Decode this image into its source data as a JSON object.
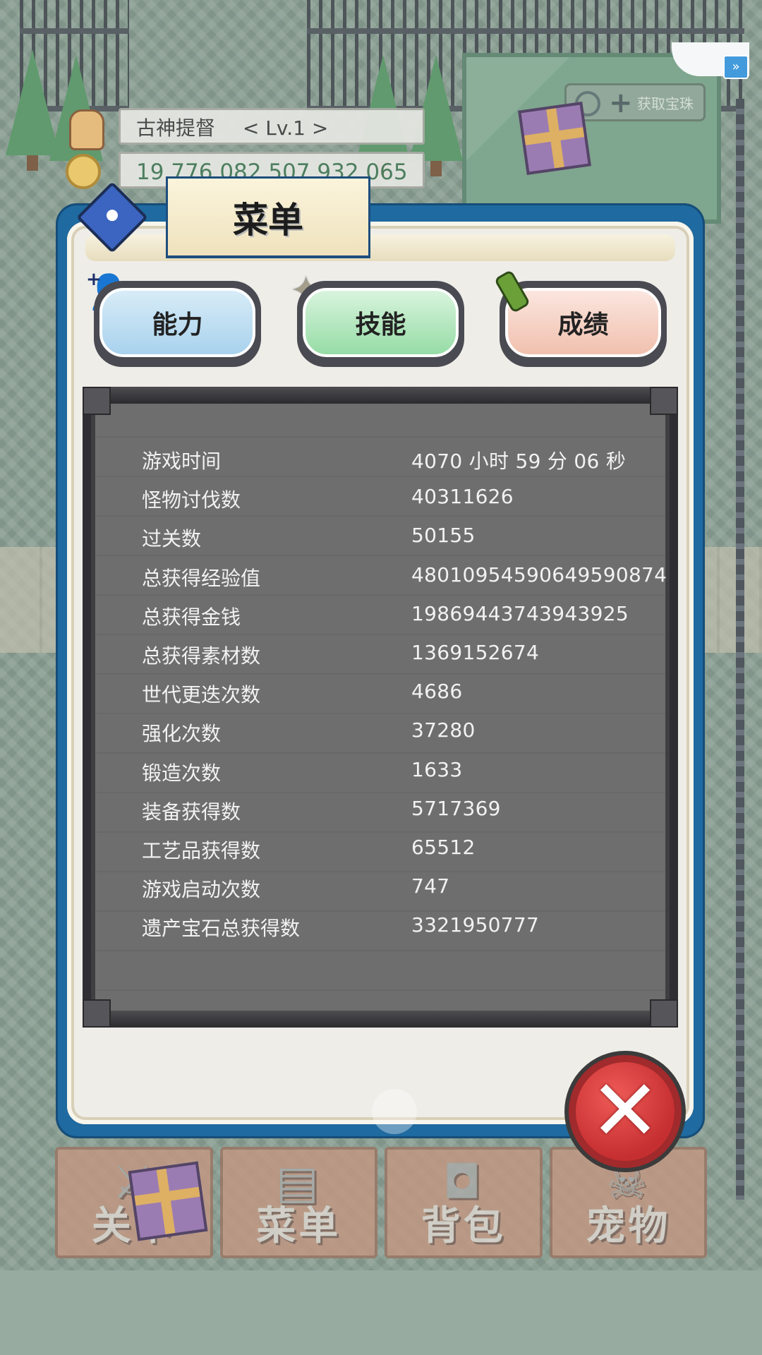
{
  "hud": {
    "player_name": "古神提督",
    "level": "< Lv.1 >",
    "gold": "19,776,082,507,932,065",
    "treasure_button": "获取宝珠",
    "fast_forward_icon": "fast-forward-icon"
  },
  "modal": {
    "title": "菜单",
    "tabs": [
      {
        "label": "能力"
      },
      {
        "label": "技能"
      },
      {
        "label": "成绩"
      }
    ],
    "stats": [
      {
        "label": "游戏时间",
        "value": "4070 小时 59 分 06 秒"
      },
      {
        "label": "怪物讨伐数",
        "value": "40311626"
      },
      {
        "label": "过关数",
        "value": "50155"
      },
      {
        "label": "总获得经验值",
        "value": "48010954590649590874"
      },
      {
        "label": "总获得金钱",
        "value": "19869443743943925"
      },
      {
        "label": "总获得素材数",
        "value": "1369152674"
      },
      {
        "label": "世代更迭次数",
        "value": "4686"
      },
      {
        "label": "强化次数",
        "value": "37280"
      },
      {
        "label": "锻造次数",
        "value": "1633"
      },
      {
        "label": "装备获得数",
        "value": "5717369"
      },
      {
        "label": "工艺品获得数",
        "value": "65512"
      },
      {
        "label": "游戏启动次数",
        "value": "747"
      },
      {
        "label": "遗产宝石总获得数",
        "value": "3321950777"
      }
    ]
  },
  "bottom_nav": [
    {
      "label": "关卡"
    },
    {
      "label": "菜单"
    },
    {
      "label": "背包"
    },
    {
      "label": "宠物"
    }
  ],
  "colors": {
    "modal_frame": "#1f6aa0",
    "board": "#6b6b6b",
    "close_button": "#c62f31"
  }
}
